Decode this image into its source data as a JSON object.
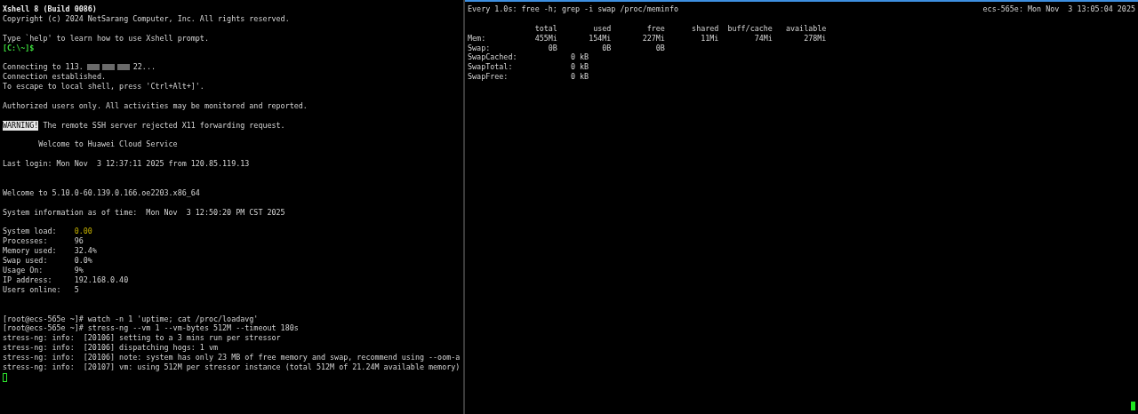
{
  "panes": [
    {
      "focused": false,
      "lines": [
        {
          "kind": "text",
          "segments": [
            {
              "kind": "bold",
              "text": "Xshell 8 (Build 0086)"
            }
          ]
        },
        {
          "kind": "text",
          "segments": [
            {
              "kind": "plain",
              "text": "Copyright (c) 2024 NetSarang Computer, Inc. All rights reserved."
            }
          ]
        },
        {
          "kind": "blank"
        },
        {
          "kind": "text",
          "segments": [
            {
              "kind": "plain",
              "text": "Type `help' to learn how to use Xshell prompt."
            }
          ]
        },
        {
          "kind": "text",
          "segments": [
            {
              "kind": "green",
              "text": "[C:\\~]$"
            }
          ]
        },
        {
          "kind": "blank"
        },
        {
          "kind": "text",
          "segments": [
            {
              "kind": "plain",
              "text": "Connecting to 113."
            },
            {
              "kind": "redacted"
            },
            {
              "kind": "plain",
              "text": "22..."
            }
          ]
        },
        {
          "kind": "text",
          "segments": [
            {
              "kind": "plain",
              "text": "Connection established."
            }
          ]
        },
        {
          "kind": "text",
          "segments": [
            {
              "kind": "plain",
              "text": "To escape to local shell, press 'Ctrl+Alt+]'."
            }
          ]
        },
        {
          "kind": "blank"
        },
        {
          "kind": "text",
          "segments": [
            {
              "kind": "plain",
              "text": "Authorized users only. All activities may be monitored and reported."
            }
          ]
        },
        {
          "kind": "blank"
        },
        {
          "kind": "text",
          "segments": [
            {
              "kind": "inverse",
              "text": "WARNING!"
            },
            {
              "kind": "plain",
              "text": " The remote SSH server rejected X11 forwarding request."
            }
          ]
        },
        {
          "kind": "blank"
        },
        {
          "kind": "text",
          "segments": [
            {
              "kind": "plain",
              "text": "        Welcome to Huawei Cloud Service"
            }
          ]
        },
        {
          "kind": "blank"
        },
        {
          "kind": "text",
          "segments": [
            {
              "kind": "plain",
              "text": "Last login: Mon Nov  3 12:37:11 2025 from 120.85.119.13"
            }
          ]
        },
        {
          "kind": "blank"
        },
        {
          "kind": "blank"
        },
        {
          "kind": "text",
          "segments": [
            {
              "kind": "plain",
              "text": "Welcome to 5.10.0-60.139.0.166.oe2203.x86_64"
            }
          ]
        },
        {
          "kind": "blank"
        },
        {
          "kind": "text",
          "segments": [
            {
              "kind": "plain",
              "text": "System information as of time:  Mon Nov  3 12:50:20 PM CST 2025"
            }
          ]
        },
        {
          "kind": "blank"
        },
        {
          "kind": "text",
          "segments": [
            {
              "kind": "plain",
              "text": "System load:    "
            },
            {
              "kind": "yellow",
              "text": "0.00"
            }
          ]
        },
        {
          "kind": "text",
          "segments": [
            {
              "kind": "plain",
              "text": "Processes:      "
            },
            {
              "kind": "plain",
              "text": "96"
            }
          ]
        },
        {
          "kind": "text",
          "segments": [
            {
              "kind": "plain",
              "text": "Memory used:    "
            },
            {
              "kind": "plain",
              "text": "32.4%"
            }
          ]
        },
        {
          "kind": "text",
          "segments": [
            {
              "kind": "plain",
              "text": "Swap used:      "
            },
            {
              "kind": "plain",
              "text": "0.0%"
            }
          ]
        },
        {
          "kind": "text",
          "segments": [
            {
              "kind": "plain",
              "text": "Usage On:       "
            },
            {
              "kind": "plain",
              "text": "9%"
            }
          ]
        },
        {
          "kind": "text",
          "segments": [
            {
              "kind": "plain",
              "text": "IP address:     "
            },
            {
              "kind": "plain",
              "text": "192.168.0.40"
            }
          ]
        },
        {
          "kind": "text",
          "segments": [
            {
              "kind": "plain",
              "text": "Users online:   "
            },
            {
              "kind": "plain",
              "text": "5"
            }
          ]
        },
        {
          "kind": "blank"
        },
        {
          "kind": "blank"
        },
        {
          "kind": "text",
          "segments": [
            {
              "kind": "plain",
              "text": "[root@ecs-565e ~]# watch -n 1 'uptime; cat /proc/loadavg'"
            }
          ]
        },
        {
          "kind": "text",
          "segments": [
            {
              "kind": "plain",
              "text": "[root@ecs-565e ~]# stress-ng --vm 1 --vm-bytes 512M --timeout 180s"
            }
          ]
        },
        {
          "kind": "text",
          "segments": [
            {
              "kind": "plain",
              "text": "stress-ng: info:  [20106] setting to a 3 mins run per stressor"
            }
          ]
        },
        {
          "kind": "text",
          "segments": [
            {
              "kind": "plain",
              "text": "stress-ng: info:  [20106] dispatching hogs: 1 vm"
            }
          ]
        },
        {
          "kind": "text",
          "segments": [
            {
              "kind": "plain",
              "text": "stress-ng: info:  [20106] note: system has only 23 MB of free memory and swap, recommend using --oom-a"
            }
          ]
        },
        {
          "kind": "text",
          "segments": [
            {
              "kind": "plain",
              "text": "stress-ng: info:  [20107] vm: using 512M per stressor instance (total 512M of 21.24M available memory)"
            }
          ]
        }
      ]
    },
    {
      "focused": true,
      "lines": [
        {
          "kind": "split",
          "left": "Every 1.0s: free -h; grep -i swap /proc/meminfo",
          "right": "ecs-565e: Mon Nov  3 13:05:04 2025"
        },
        {
          "kind": "blank"
        },
        {
          "kind": "text",
          "segments": [
            {
              "kind": "plain",
              "text": "               total        used        free      shared  buff/cache   available"
            }
          ]
        },
        {
          "kind": "text",
          "segments": [
            {
              "kind": "plain",
              "text": "Mem:           455Mi       154Mi       227Mi        11Mi        74Mi       278Mi"
            }
          ]
        },
        {
          "kind": "text",
          "segments": [
            {
              "kind": "plain",
              "text": "Swap:             0B          0B          0B"
            }
          ]
        },
        {
          "kind": "text",
          "segments": [
            {
              "kind": "plain",
              "text": "SwapCached:            0 kB"
            }
          ]
        },
        {
          "kind": "text",
          "segments": [
            {
              "kind": "plain",
              "text": "SwapTotal:             0 kB"
            }
          ]
        },
        {
          "kind": "text",
          "segments": [
            {
              "kind": "plain",
              "text": "SwapFree:              0 kB"
            }
          ]
        }
      ]
    }
  ]
}
